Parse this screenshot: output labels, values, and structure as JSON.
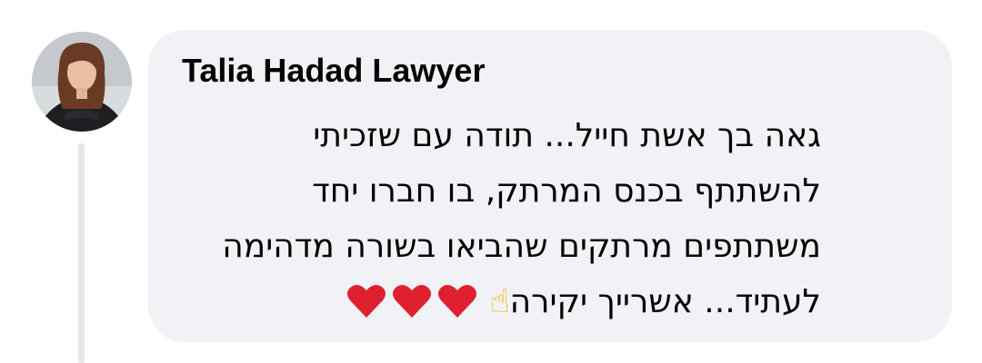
{
  "comment": {
    "author": "Talia Hadad Lawyer",
    "lines": [
      "גאה בך אשת חייל... תודה עם שזכיתי",
      "להשתתף בכנס המרתק, בו חברו יחד",
      "משתתפים מרתקים שהביאו בשורה מדהימה",
      "לעתיד... אשרייך יקירה"
    ],
    "emoji_hand": "☝",
    "hearts": [
      "heart-icon",
      "heart-icon",
      "heart-icon"
    ],
    "heart_color": "#e0202e",
    "bubble_color": "#f0f2f5"
  }
}
